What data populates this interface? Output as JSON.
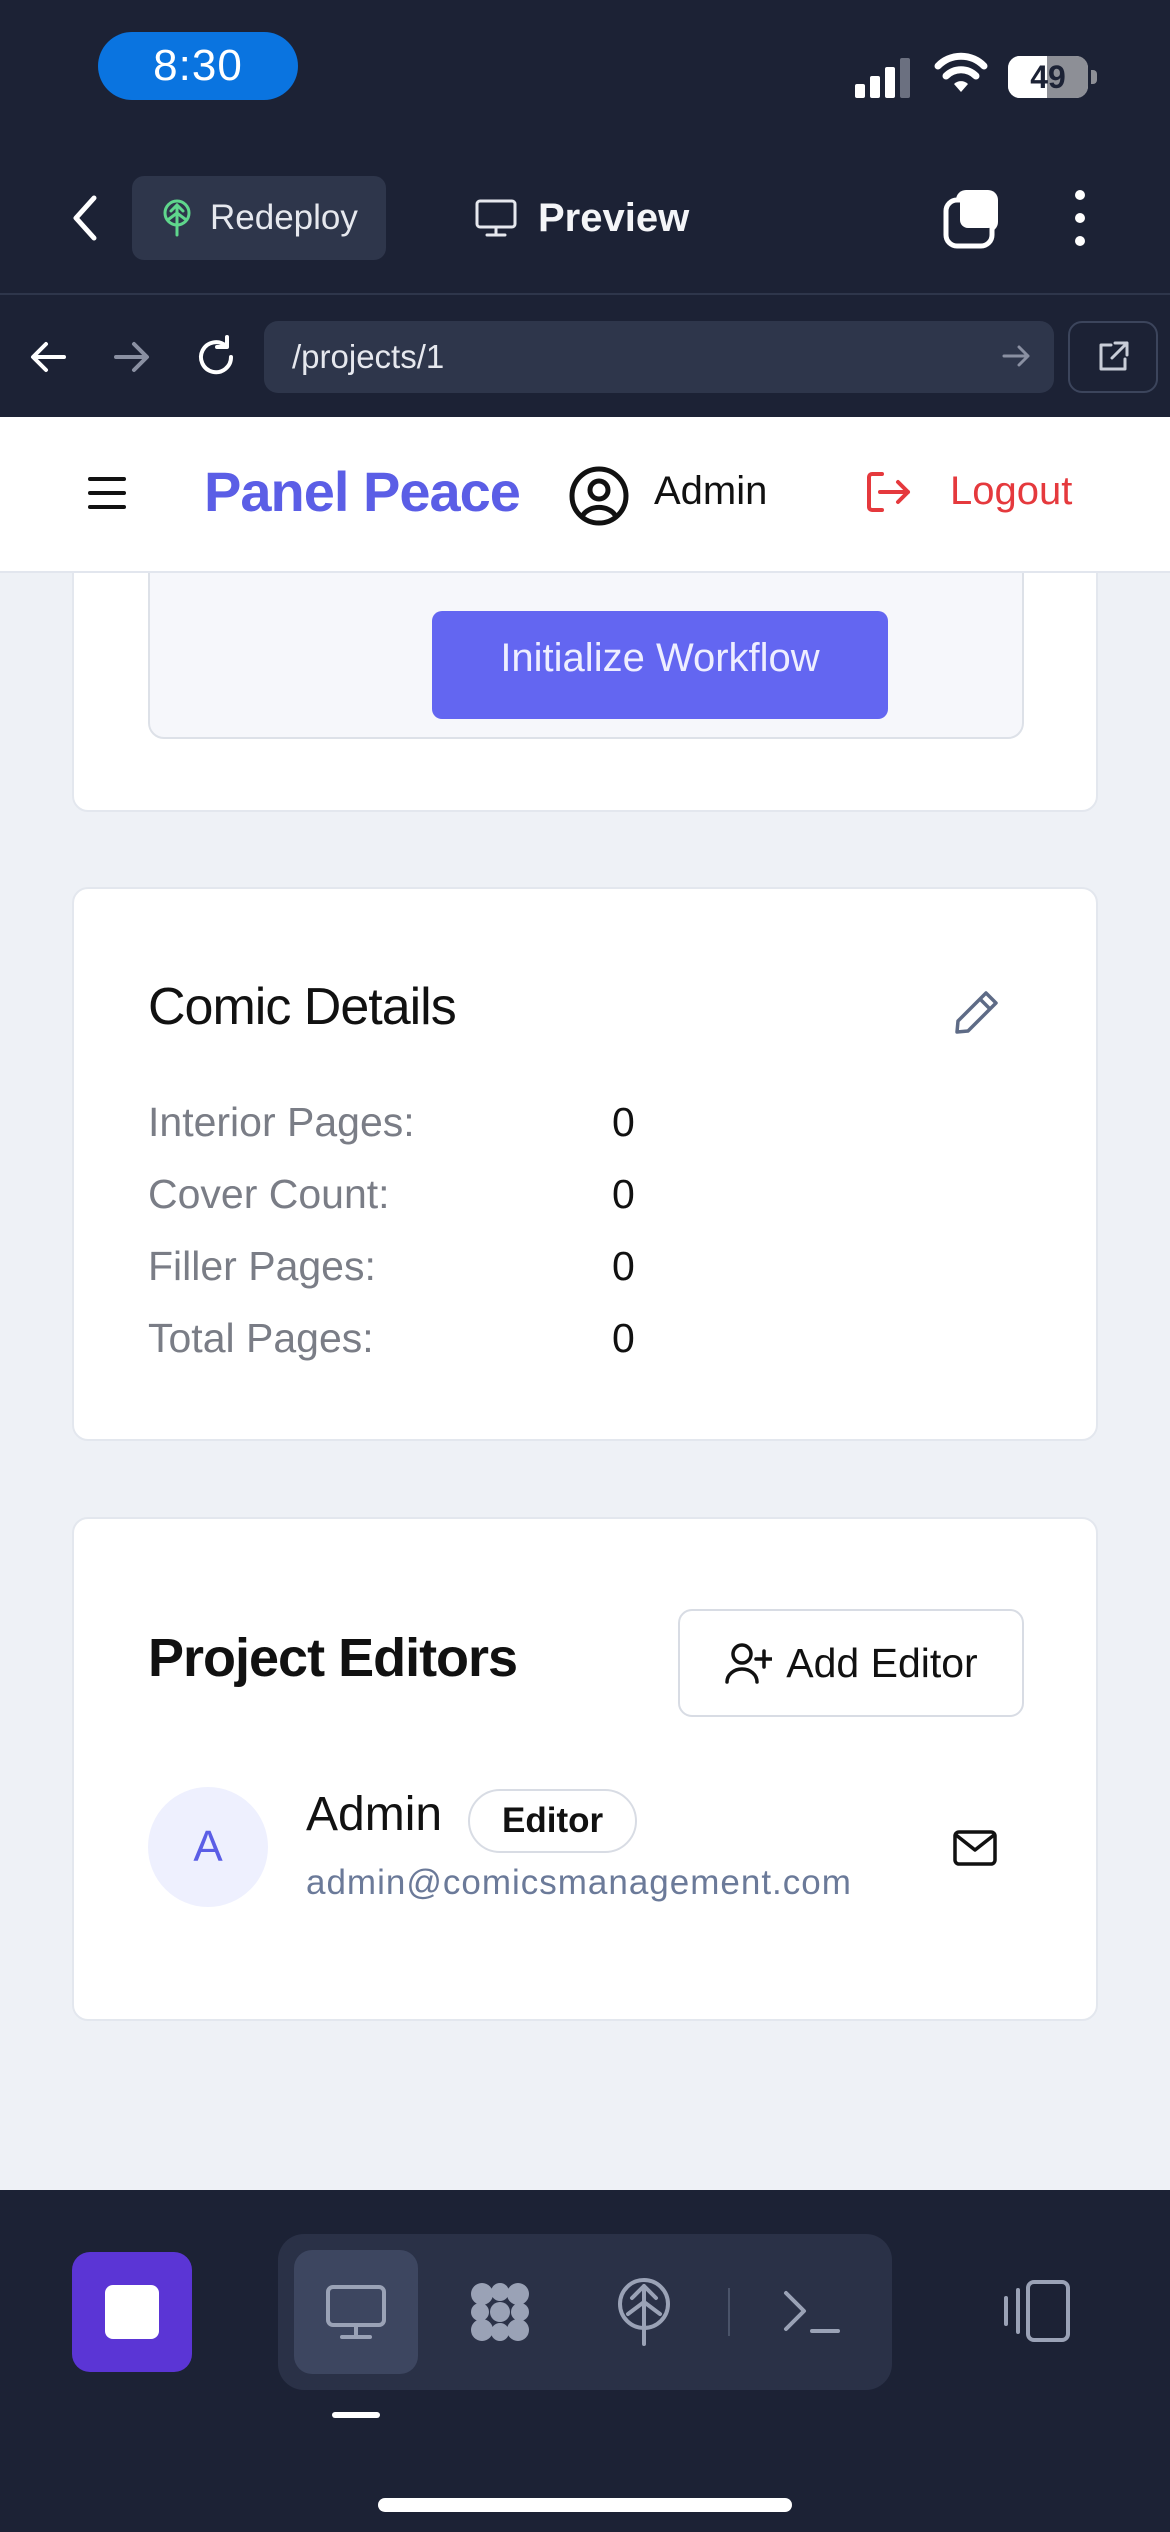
{
  "status_bar": {
    "time": "8:30",
    "battery_level": "49",
    "icons": [
      "signal-icon",
      "wifi-icon",
      "battery-icon"
    ]
  },
  "app_toolbar": {
    "redeploy_label": "Redeploy",
    "preview_label": "Preview",
    "icons": [
      "back-icon",
      "redeploy-icon",
      "monitor-icon",
      "tabs-icon",
      "more-icon"
    ]
  },
  "browser_bar": {
    "url": "/projects/1",
    "icons": [
      "arrow-back-icon",
      "arrow-forward-icon",
      "reload-icon",
      "go-arrow-icon",
      "external-link-icon"
    ]
  },
  "site": {
    "brand": "Panel Peace",
    "user": "Admin",
    "logout_label": "Logout",
    "colors": {
      "brand": "#5b5ee6",
      "logout": "#e5393d"
    }
  },
  "workflow": {
    "button_label": "Initialize Workflow"
  },
  "comic_details": {
    "title": "Comic Details",
    "rows": [
      {
        "label": "Interior Pages:",
        "value": "0"
      },
      {
        "label": "Cover Count:",
        "value": "0"
      },
      {
        "label": "Filler Pages:",
        "value": "0"
      },
      {
        "label": "Total Pages:",
        "value": "0"
      }
    ]
  },
  "project_editors": {
    "title": "Project Editors",
    "add_label": "Add Editor",
    "editors": [
      {
        "initial": "A",
        "name": "Admin",
        "role": "Editor",
        "email": "admin@comicsmanagement.com"
      }
    ]
  },
  "dock": {
    "active_tab": "preview",
    "items": [
      "stop-icon",
      "monitor-icon",
      "apps-icon",
      "deploy-icon",
      "terminal-icon",
      "devices-icon"
    ]
  }
}
